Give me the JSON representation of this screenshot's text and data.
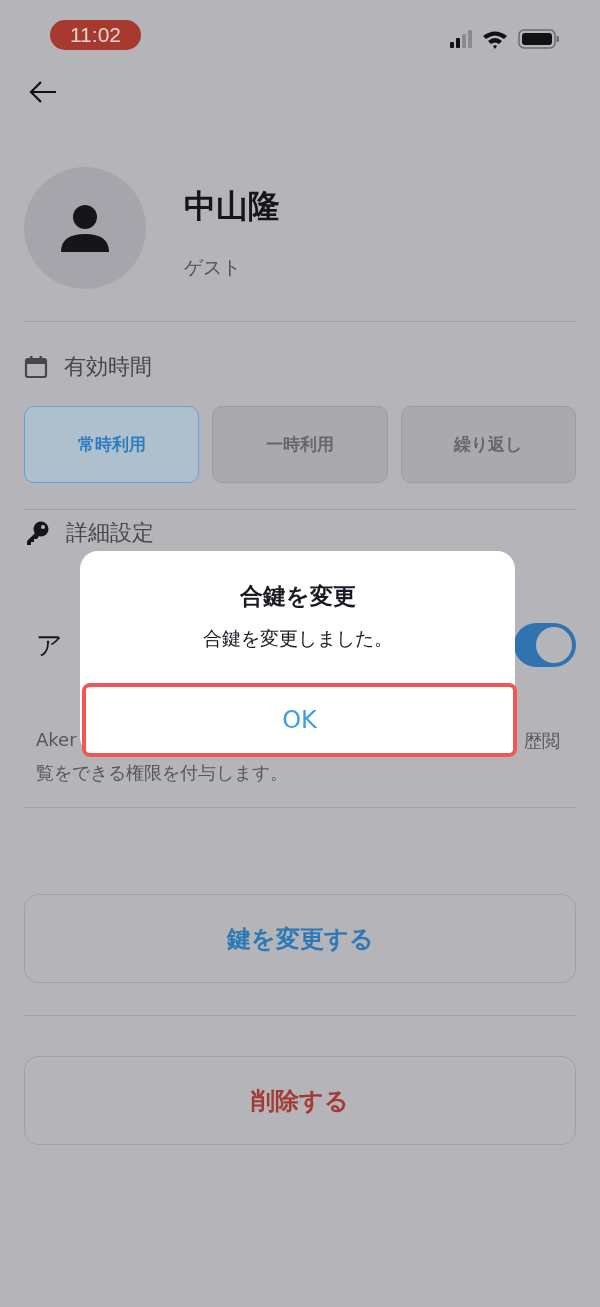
{
  "status_bar": {
    "time": "11:02"
  },
  "profile": {
    "name": "中山隆",
    "role": "ゲスト"
  },
  "validity": {
    "label": "有効時間",
    "options": [
      {
        "label": "常時利用",
        "selected": true
      },
      {
        "label": "一時利用",
        "selected": false
      },
      {
        "label": "繰り返し",
        "selected": false
      }
    ]
  },
  "details": {
    "label": "詳細設定",
    "setting_label": "ア",
    "toggle_on": true,
    "description_start": "Aker",
    "description_end": "歴閲",
    "description_line_2": "覧をできる権限を付与します。"
  },
  "buttons": [
    {
      "label": "鍵を変更する",
      "kind": "primary"
    },
    {
      "label": "削除する",
      "kind": "danger"
    }
  ],
  "dialog": {
    "title": "合鍵を変更",
    "message": "合鍵を変更しました。",
    "button": "OK"
  }
}
